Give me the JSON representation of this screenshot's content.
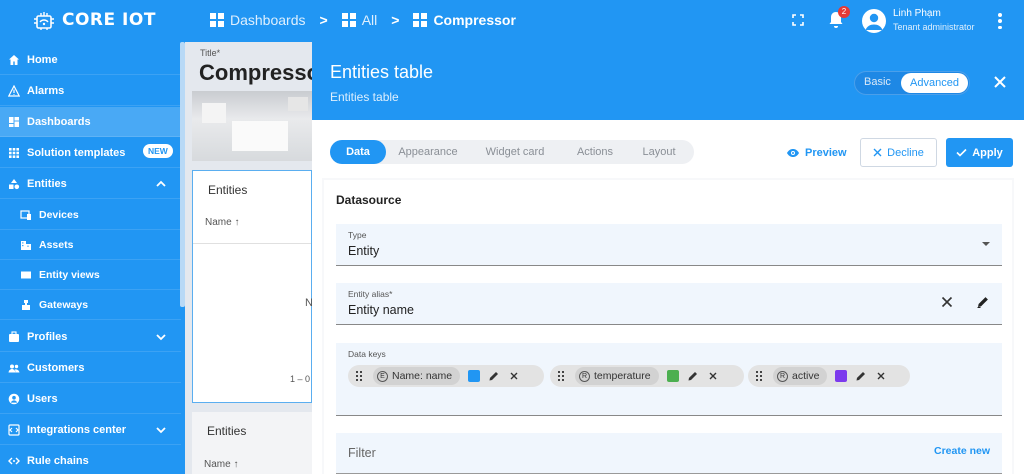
{
  "app": {
    "logo_text": "CORE IOT"
  },
  "breadcrumb": [
    {
      "label": "Dashboards"
    },
    {
      "label": "All"
    },
    {
      "label": "Compressor"
    }
  ],
  "breadcrumb_separator": ">",
  "notifications": {
    "count": "2"
  },
  "user": {
    "name": "Linh Phạm",
    "role": "Tenant administrator"
  },
  "sidebar": {
    "items": [
      {
        "label": "Home",
        "icon": "home-icon"
      },
      {
        "label": "Alarms",
        "icon": "warning-icon"
      },
      {
        "label": "Dashboards",
        "icon": "dashboard-icon",
        "selected": true
      },
      {
        "label": "Solution templates",
        "icon": "apps-icon",
        "badge": "NEW"
      },
      {
        "label": "Entities",
        "icon": "entities-icon",
        "expanded": true
      },
      {
        "label": "Devices",
        "icon": "devices-icon",
        "sub": true
      },
      {
        "label": "Assets",
        "icon": "assets-icon",
        "sub": true
      },
      {
        "label": "Entity views",
        "icon": "entity-views-icon",
        "sub": true
      },
      {
        "label": "Gateways",
        "icon": "gateways-icon",
        "sub": true
      },
      {
        "label": "Profiles",
        "icon": "profiles-icon",
        "collapsed": true
      },
      {
        "label": "Customers",
        "icon": "customers-icon"
      },
      {
        "label": "Users",
        "icon": "users-icon"
      },
      {
        "label": "Integrations center",
        "icon": "integrations-icon",
        "collapsed": true
      },
      {
        "label": "Rule chains",
        "icon": "rule-chains-icon"
      }
    ]
  },
  "dashboard": {
    "title_label": "Title*",
    "title": "Compressor",
    "card1": {
      "title": "Entities",
      "column": "Name",
      "row_partial": "N",
      "pagination_partial": "1 – 0"
    },
    "card2": {
      "title": "Entities",
      "column": "Name"
    }
  },
  "editor": {
    "title": "Entities table",
    "subtitle": "Entities table",
    "mode_basic": "Basic",
    "mode_advanced": "Advanced",
    "tabs": [
      {
        "label": "Data",
        "active": true
      },
      {
        "label": "Appearance"
      },
      {
        "label": "Widget card"
      },
      {
        "label": "Actions"
      },
      {
        "label": "Layout"
      }
    ],
    "preview_label": "Preview",
    "decline_label": "Decline",
    "apply_label": "Apply",
    "datasource": {
      "title": "Datasource",
      "type_label": "Type",
      "type_value": "Entity",
      "alias_label": "Entity alias*",
      "alias_value": "Entity name",
      "data_keys_label": "Data keys",
      "keys": [
        {
          "label": "Name: name",
          "type_glyph": "E",
          "color": "#2196f3"
        },
        {
          "label": "temperature",
          "type_glyph": "R",
          "color": "#4caf50"
        },
        {
          "label": "active",
          "type_glyph": "R",
          "color": "#7c3aed"
        }
      ],
      "filter_placeholder": "Filter",
      "create_new_label": "Create new"
    }
  },
  "colors": {
    "brand": "#2196f3",
    "badge": "#e53935"
  }
}
